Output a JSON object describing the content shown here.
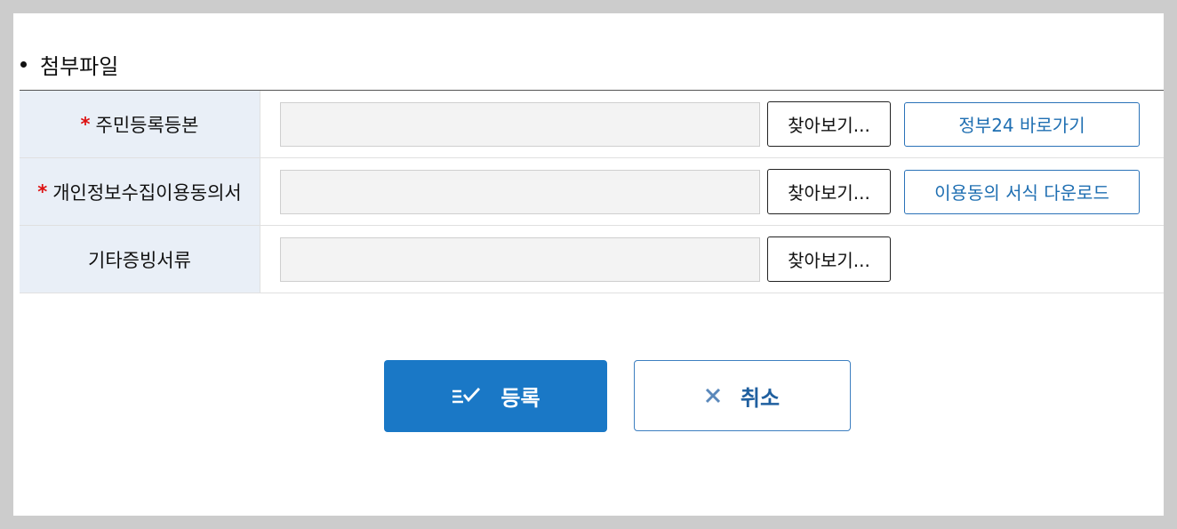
{
  "section": {
    "title": "첨부파일"
  },
  "rows": [
    {
      "required": true,
      "required_mark": "*",
      "label": "주민등록등본",
      "browse_label": "찾아보기...",
      "extra_button": "정부24 바로가기"
    },
    {
      "required": true,
      "required_mark": "*",
      "label": "개인정보수집이용동의서",
      "browse_label": "찾아보기...",
      "extra_button": "이용동의 서식 다운로드"
    },
    {
      "required": false,
      "label": "기타증빙서류",
      "browse_label": "찾아보기..."
    }
  ],
  "actions": {
    "register_label": "등록",
    "register_icon": "checklist-icon",
    "cancel_label": "취소",
    "cancel_icon": "close-icon"
  },
  "colors": {
    "primary": "#1a78c6",
    "label_bg": "#e9eff7",
    "required": "#dd1111",
    "link": "#1f6fb2"
  }
}
